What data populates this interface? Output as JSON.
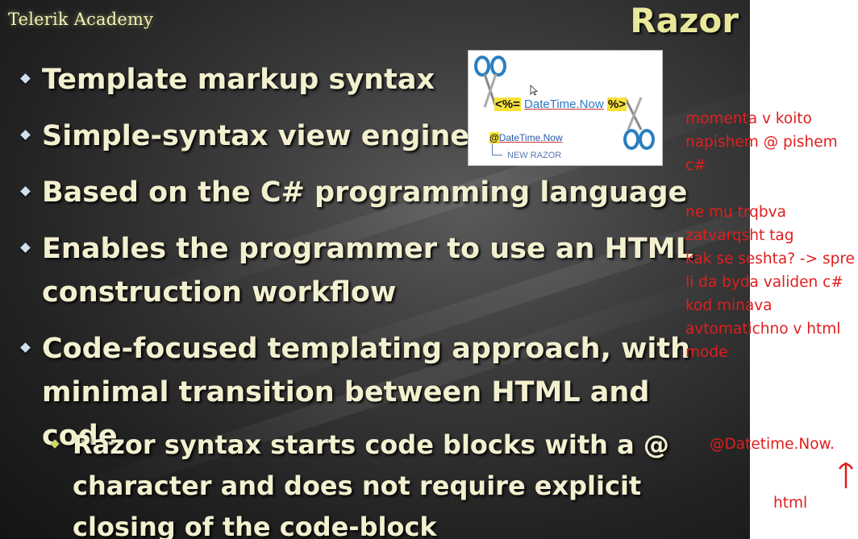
{
  "slide": {
    "logo": "Telerik Academy",
    "title": "Razor",
    "bullets": [
      "Template markup syntax",
      "Simple-syntax view engine",
      "Based on the C# programming language",
      "Enables the programmer to use an HTML construction workflow",
      "Code-focused templating approach, with minimal transition between HTML and code"
    ],
    "sub_bullet": "Razor syntax starts code blocks with a @ character and does not require explicit closing of the code-block"
  },
  "figure": {
    "old_open": "<%=",
    "old_code": "DateTime.Now",
    "old_close": "%>",
    "new_at": "@",
    "new_code": "DateTime.Now",
    "new_label": "NEW RAZOR",
    "accent": "#f8e23a"
  },
  "annotations": {
    "notes": [
      "momenta v koito",
      "napishem @ pishem",
      "c#",
      "",
      "ne mu trqbva",
      "zatvarqsht tag",
      "kak se seshta? -> spre",
      "li da byda validen c#",
      "kod minava",
      "avtomatichno v html",
      "mode"
    ],
    "datetime_note": "@Datetime.Now.",
    "html_note": "html",
    "color": "#e01e1e"
  }
}
